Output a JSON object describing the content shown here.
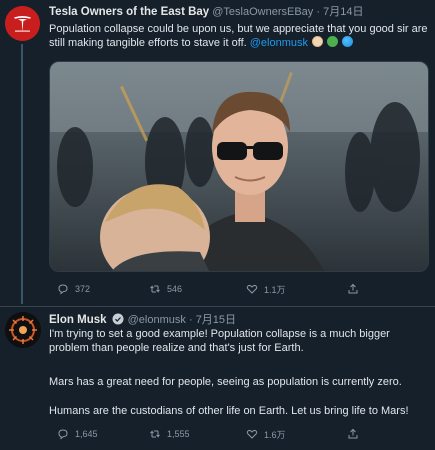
{
  "tweets": [
    {
      "display_name": "Tesla Owners of the East Bay",
      "handle": "@TeslaOwnersEBay",
      "separator": "·",
      "date": "7月14日",
      "text": "Population collapse could be upon us, but we appreciate that you good sir are still making tangible efforts to stave it off.",
      "mention": "@elonmusk",
      "emojis": [
        "baby-emoji",
        "green-heart-emoji",
        "globe-emoji"
      ],
      "replies": "372",
      "retweets": "546",
      "likes": "1.1万"
    },
    {
      "display_name": "Elon Musk",
      "handle": "@elonmusk",
      "separator": "·",
      "date": "7月15日",
      "text_1": "I'm trying to set a good example! Population collapse is a much bigger problem than people realize and that's just for Earth.",
      "text_2": "Mars has a great need for people, seeing as population is currently zero.",
      "text_3": "Humans are the custodians of other life on Earth. Let us bring life to Mars!",
      "replies": "1,645",
      "retweets": "1,555",
      "likes": "1.6万"
    }
  ],
  "icons": [
    "reply-icon",
    "retweet-icon",
    "like-icon",
    "share-icon",
    "verified-badge-icon"
  ],
  "colors": {
    "background": "#15202b",
    "accent": "#1d9bf0",
    "secondary_text": "#8b98a5",
    "tesla_red": "#cc1f1f"
  }
}
